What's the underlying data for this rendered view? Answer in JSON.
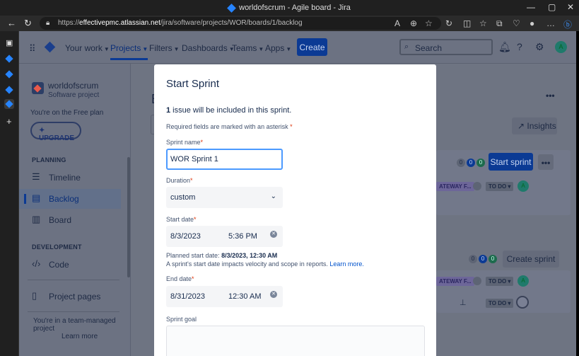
{
  "browser": {
    "window_title": "worldofscrum - Agile board - Jira",
    "url_host": "effectivepmc.atlassian.net",
    "url_path": "/jira/software/projects/WOR/boards/1/backlog",
    "url_scheme": "https://",
    "window_buttons": [
      "—",
      "▢",
      "✕"
    ]
  },
  "topnav": {
    "items": [
      {
        "label": "Your work"
      },
      {
        "label": "Projects"
      },
      {
        "label": "Filters"
      },
      {
        "label": "Dashboards"
      },
      {
        "label": "Teams"
      },
      {
        "label": "Apps"
      }
    ],
    "create_label": "Create",
    "search_placeholder": "Search",
    "avatar_initial": "A",
    "accent": "#0052cc"
  },
  "sidebar": {
    "project_name": "worldofscrum",
    "project_type": "Software project",
    "plan_text": "You're on the Free plan",
    "upgrade_label": "UPGRADE",
    "planning_heading": "PLANNING",
    "planning_items": [
      {
        "label": "Timeline",
        "icon": "timeline-icon"
      },
      {
        "label": "Backlog",
        "icon": "backlog-icon"
      },
      {
        "label": "Board",
        "icon": "board-icon"
      }
    ],
    "development_heading": "DEVELOPMENT",
    "development_items": [
      {
        "label": "Code",
        "icon": "code-icon"
      }
    ],
    "project_pages_label": "Project pages",
    "footer_text": "You're in a team-managed project",
    "learn_more": "Learn more"
  },
  "backlog": {
    "breadcrumb_initial": "P",
    "title_initial": "B",
    "insights_label": "Insights",
    "start_sprint_label": "Start sprint",
    "create_sprint_label": "Create sprint",
    "counts": [
      "0",
      "0",
      "0"
    ],
    "epic_label": "ATEWAY F...",
    "status_label": "TO DO",
    "avatar_initial": "A",
    "more_label": "•••"
  },
  "modal": {
    "title": "Start Sprint",
    "issue_count": "1",
    "issue_text": " issue will be included in this sprint.",
    "required_note": "Required fields are marked with an asterisk",
    "sprint_name_label": "Sprint name",
    "sprint_name_value": "WOR Sprint 1",
    "duration_label": "Duration",
    "duration_value": "custom",
    "start_date_label": "Start date",
    "start_date": "8/3/2023",
    "start_time": "5:36 PM",
    "planned_prefix": "Planned start date: ",
    "planned_value": "8/3/2023, 12:30 AM",
    "impact_text": "A sprint's start date impacts velocity and scope in reports. ",
    "impact_link": "Learn more.",
    "end_date_label": "End date",
    "end_date": "8/31/2023",
    "end_time": "12:30 AM",
    "sprint_goal_label": "Sprint goal",
    "asterisk": "*"
  }
}
